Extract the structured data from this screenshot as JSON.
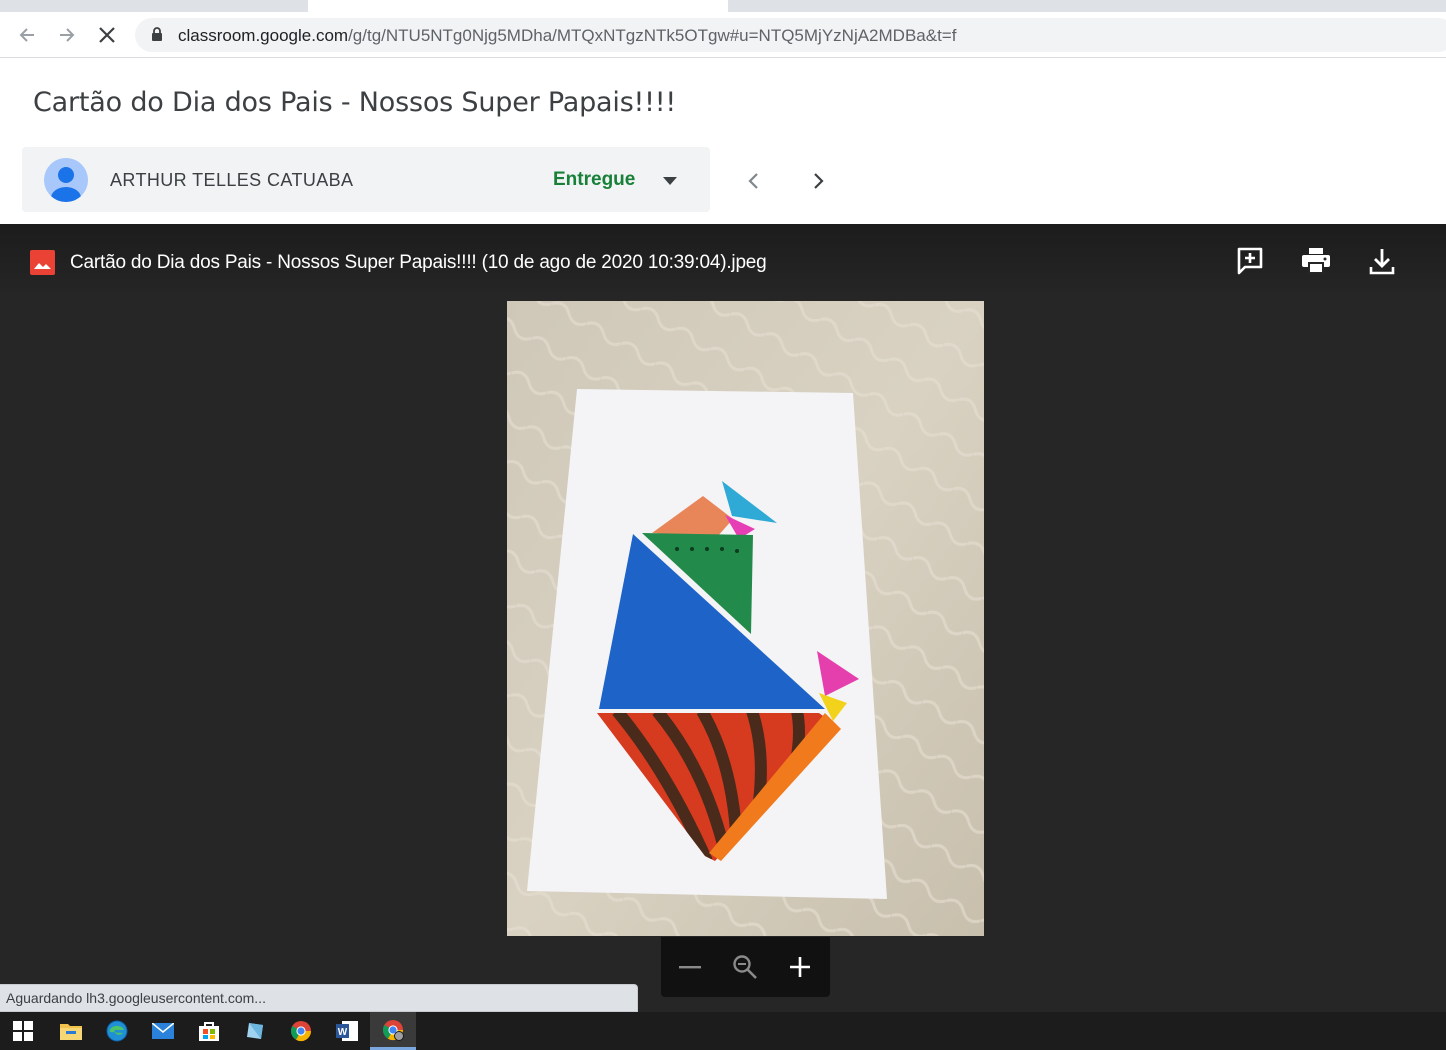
{
  "browser": {
    "url_host": "classroom.google.com",
    "url_path": "/g/tg/NTU5NTg0Njg5MDha/MTQxNTgzNTk5OTgw#u=NTQ5MjYzNjA2MDBa&t=f",
    "back_icon": "arrow-left-icon",
    "forward_icon": "arrow-right-icon",
    "stop_icon": "close-icon",
    "lock_icon": "lock-icon"
  },
  "classroom": {
    "assignment_title": "Cartão do Dia dos Pais - Nossos Super Papais!!!!",
    "student_name": "ARTHUR TELLES CATUABA",
    "status": "Entregue",
    "status_color": "#188038"
  },
  "viewer": {
    "file_name": "Cartão do Dia dos Pais - Nossos Super Papais!!!! (10 de ago de 2020 10:39:04).jpeg",
    "actions": [
      "add-comment-icon",
      "print-icon",
      "download-icon"
    ],
    "zoom_controls": [
      "zoom-out-icon",
      "zoom-reset-icon",
      "zoom-in-icon"
    ]
  },
  "status_bar": {
    "text": "Aguardando lh3.googleusercontent.com..."
  },
  "taskbar": {
    "items": [
      "windows-start-icon",
      "file-explorer-icon",
      "edge-icon",
      "mail-icon",
      "store-icon",
      "app-icon",
      "chrome-icon",
      "word-icon",
      "chrome-profile-icon"
    ]
  }
}
